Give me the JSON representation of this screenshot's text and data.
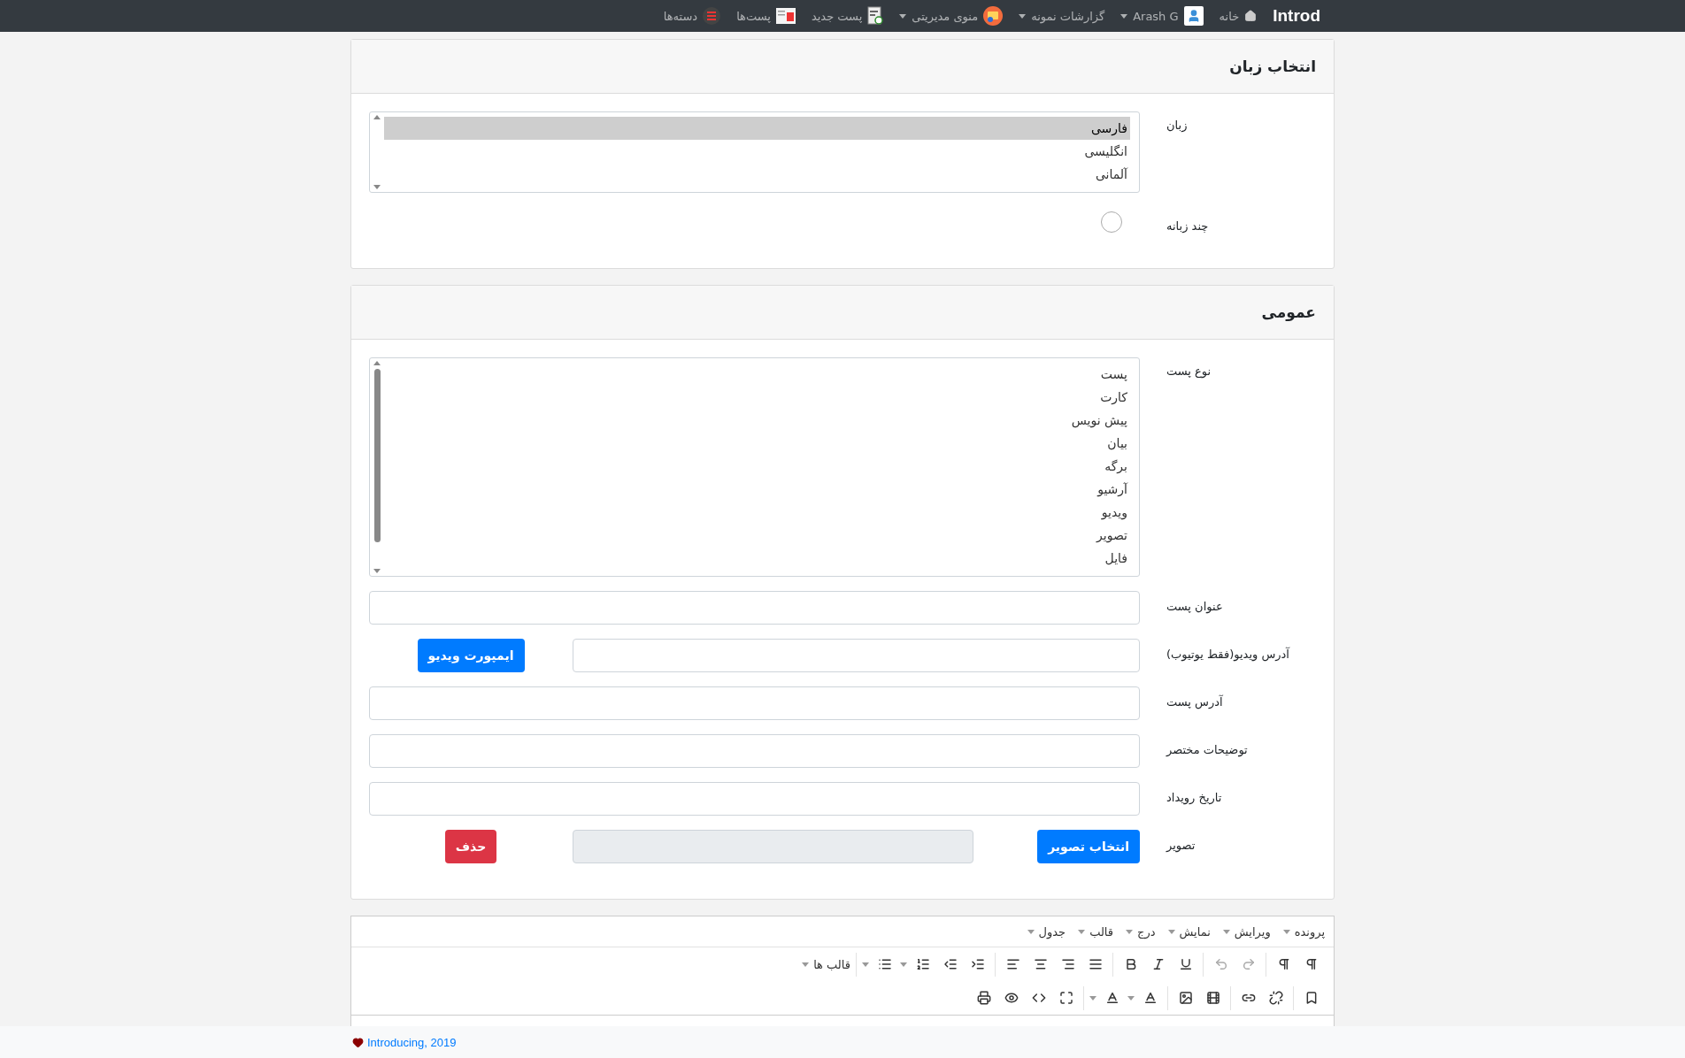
{
  "navbar": {
    "brand": "Introd",
    "items": [
      {
        "label": "خانه",
        "kind": "home",
        "dropdown": false
      },
      {
        "label": "Arash G",
        "kind": "user",
        "dropdown": true
      },
      {
        "label": "گزارشات نمونه",
        "kind": "plain",
        "dropdown": true
      },
      {
        "label": "منوی مدیریتی",
        "kind": "admin",
        "dropdown": true
      },
      {
        "label": "پست جدید",
        "kind": "newpost",
        "dropdown": false
      },
      {
        "label": "پست‌ها",
        "kind": "posts",
        "dropdown": false
      },
      {
        "label": "دسته‌ها",
        "kind": "categories",
        "dropdown": false
      }
    ]
  },
  "language_card": {
    "title": "انتخاب زبان",
    "fields": [
      {
        "kind": "listbox",
        "label": "زبان",
        "options": [
          {
            "label": "فارسی",
            "selected": true
          },
          {
            "label": "انگلیسی",
            "selected": false
          },
          {
            "label": "آلمانی",
            "selected": false
          }
        ]
      },
      {
        "kind": "radio",
        "label": "چند زبانه",
        "checked": false
      }
    ]
  },
  "general_card": {
    "title": "عمومی",
    "fields": [
      {
        "kind": "listbox",
        "label": "نوع پست",
        "options": [
          {
            "label": "پست",
            "selected": false
          },
          {
            "label": "کارت",
            "selected": false
          },
          {
            "label": "پیش نویس",
            "selected": false
          },
          {
            "label": "بیان",
            "selected": false
          },
          {
            "label": "برگه",
            "selected": false
          },
          {
            "label": "آرشیو",
            "selected": false
          },
          {
            "label": "ویدیو",
            "selected": false
          },
          {
            "label": "تصویر",
            "selected": false
          },
          {
            "label": "فایل",
            "selected": false
          }
        ]
      },
      {
        "kind": "text",
        "label": "عنوان پست"
      },
      {
        "kind": "text_button",
        "label": "آدرس ویدیو(فقط یوتیوب)",
        "button": "ایمپورت ویدیو"
      },
      {
        "kind": "text",
        "label": "آدرس پست"
      },
      {
        "kind": "text",
        "label": "توضیحات مختصر"
      },
      {
        "kind": "text",
        "label": "تاریخ رویداد"
      },
      {
        "kind": "image",
        "label": "تصویر",
        "choose_button": "انتخاب تصویر",
        "delete_button": "حذف"
      }
    ]
  },
  "editor": {
    "menu": [
      "پرونده",
      "ویرایش",
      "نمایش",
      "درج",
      "قالب",
      "جدول"
    ],
    "formats_dropdown": "قالب ها"
  },
  "footer": {
    "link": "Introducing, 2019"
  }
}
